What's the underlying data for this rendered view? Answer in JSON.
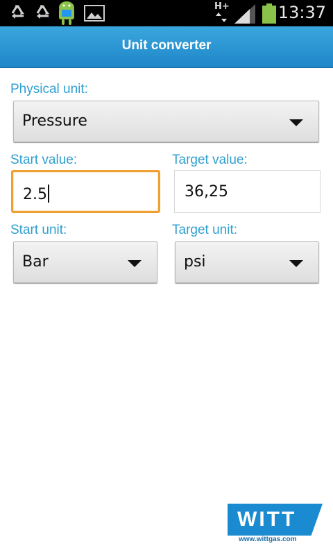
{
  "status_bar": {
    "time": "13:37",
    "network_label": "H+",
    "icons": [
      "recycle-icon",
      "recycle-icon",
      "android-icon",
      "image-icon",
      "signal-icon",
      "battery-icon"
    ]
  },
  "app": {
    "title": "Unit converter"
  },
  "form": {
    "physical_unit_label": "Physical unit:",
    "physical_unit_value": "Pressure",
    "start_value_label": "Start value:",
    "start_value": "2.5",
    "target_value_label": "Target value:",
    "target_value": "36,25",
    "start_unit_label": "Start unit:",
    "start_unit_value": "Bar",
    "target_unit_label": "Target unit:",
    "target_unit_value": "psi"
  },
  "logo": {
    "brand": "WITT",
    "url": "www.wittgas.com"
  },
  "colors": {
    "accent": "#2f9fd0",
    "title_bar": "#2490d0",
    "focus": "#f0a033"
  }
}
